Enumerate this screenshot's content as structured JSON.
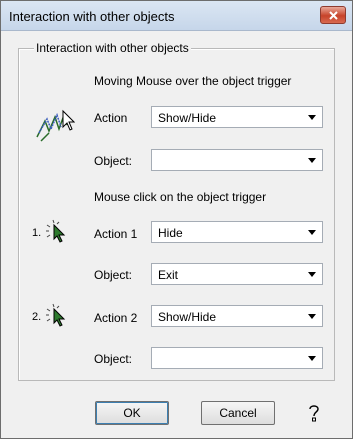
{
  "window": {
    "title": "Interaction with other objects"
  },
  "group": {
    "legend": "Interaction with other objects"
  },
  "mouse_over": {
    "heading": "Moving Mouse over the object trigger",
    "action_label": "Action",
    "action_value": "Show/Hide",
    "object_label": "Object:",
    "object_value": ""
  },
  "mouse_click": {
    "heading": "Mouse click on the object trigger",
    "step1_number": "1.",
    "action1_label": "Action 1",
    "action1_value": "Hide",
    "object1_label": "Object:",
    "object1_value": "Exit",
    "step2_number": "2.",
    "action2_label": "Action 2",
    "action2_value": "Show/Hide",
    "object2_label": "Object:",
    "object2_value": ""
  },
  "buttons": {
    "ok": "OK",
    "cancel": "Cancel"
  },
  "icons": {
    "close": "close-icon",
    "mouse_over": "mouse-over-trigger-icon",
    "click": "mouse-click-icon",
    "help": "help-icon",
    "dropdown": "chevron-down-icon"
  },
  "colors": {
    "close_button": "#c7432a",
    "dialog_background": "#f0f0f0",
    "title_bar": "#c6d6ea"
  }
}
